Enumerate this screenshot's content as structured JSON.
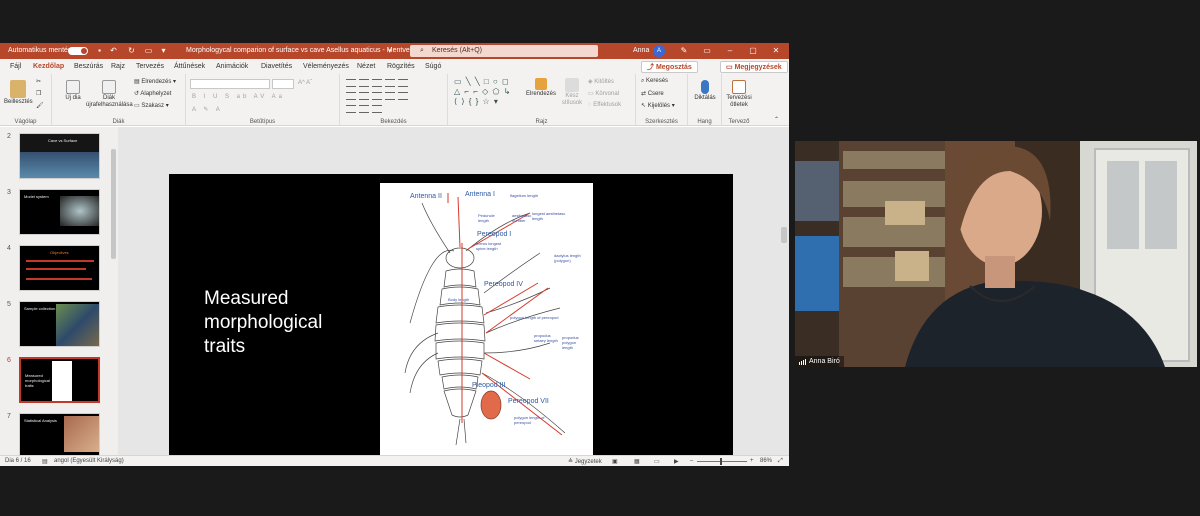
{
  "window": {
    "autosave_label": "Automatikus mentés",
    "title": "Morphologycal comparion of surface vs cave Asellus aquaticus  -  Mentve",
    "search_placeholder": "Keresés (Alt+Q)",
    "user_name": "Anna",
    "user_initial": "A"
  },
  "tabs": [
    "Fájl",
    "Kezdőlap",
    "Beszúrás",
    "Rajz",
    "Tervezés",
    "Áttűnések",
    "Animációk",
    "Diavetítés",
    "Véleményezés",
    "Nézet",
    "Rögzítés",
    "Súgó"
  ],
  "active_tab": "Kezdőlap",
  "share_label": "Megosztás",
  "comments_label": "Megjegyzések",
  "ribbon": {
    "clipboard": {
      "label": "Vágólap",
      "paste": "Beillesztés"
    },
    "slides": {
      "label": "Diák",
      "new_slide": "Új dia",
      "reuse": "Diák újrafelhasználása",
      "layout": "Elrendezés",
      "reset": "Alaphelyzet",
      "section": "Szakasz"
    },
    "font": {
      "label": "Betűtípus"
    },
    "paragraph": {
      "label": "Bekezdés"
    },
    "drawing": {
      "label": "Rajz",
      "arrange": "Elrendezés",
      "quick_styles": "Kész stílusok",
      "fill": "Kitöltés",
      "outline": "Körvonal",
      "effects": "Effektusok"
    },
    "editing": {
      "label": "Szerkesztés",
      "find": "Keresés",
      "replace": "Csere",
      "select": "Kijelölés"
    },
    "voice": {
      "label": "Hang",
      "dictate": "Diktálás"
    },
    "designer": {
      "label": "Tervező",
      "ideas": "Tervezési ötletek"
    }
  },
  "thumbnails": [
    {
      "number": "2",
      "text": "Cave vs Surface"
    },
    {
      "number": "3",
      "text": "Model system"
    },
    {
      "number": "4",
      "text": "Objectives"
    },
    {
      "number": "5",
      "text": "Sample collection"
    },
    {
      "number": "6",
      "text": "Measured morphological traits"
    },
    {
      "number": "7",
      "text": "Statistical Analysis"
    }
  ],
  "selected_slide": "6",
  "slide": {
    "title_line1": "Measured",
    "title_line2": "morphological",
    "title_line3": "traits",
    "figure_labels": {
      "antenna2": "Antenna II",
      "antenna1": "Antenna I",
      "pereopod1": "Pereopod I",
      "pereopod4": "Pereopod IV",
      "pleopod3": "Pleopod III",
      "pereopod7": "Pereopod VII",
      "flagellum": "flagellum length",
      "peduncle": "Peduncle length",
      "aesthetasc_number": "aesthetasc number",
      "aesthetasc_length": "longest aesthetasc length",
      "dactylus": "dactylus length (polygon)",
      "merus_spine": "merus longest spine length",
      "body_length": "Body length",
      "polygon_pereopod": "polygon length of pereopod",
      "propodus_setae": "propodus setaey length",
      "propodus_polygon": "propodus polygon length",
      "polygon_length_vii": "polygon length of pereopod"
    }
  },
  "status": {
    "slide_counter": "Dia 6 / 16",
    "language": "angol (Egyesült Királyság)",
    "notes": "Jegyzetek",
    "zoom": "86%"
  },
  "video": {
    "participant_name": "Anna Biró"
  },
  "colors": {
    "ppt_accent": "#b7472a",
    "selection": "#c0392b",
    "figure_label": "#2b5aa6"
  }
}
